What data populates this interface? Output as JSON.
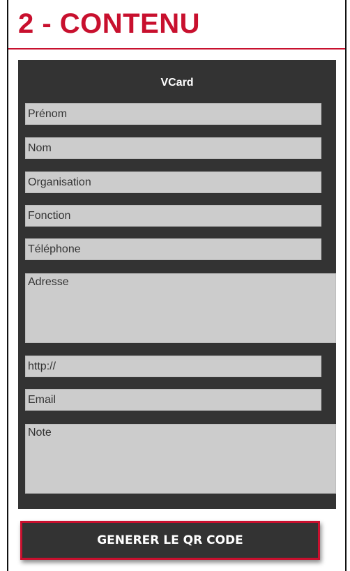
{
  "section": {
    "title": "2 - CONTENU"
  },
  "vcard": {
    "title": "VCard",
    "fields": {
      "first_name": {
        "placeholder": "Prénom",
        "value": ""
      },
      "last_name": {
        "placeholder": "Nom",
        "value": ""
      },
      "organisation": {
        "placeholder": "Organisation",
        "value": ""
      },
      "function": {
        "placeholder": "Fonction",
        "value": ""
      },
      "phone": {
        "placeholder": "Téléphone",
        "value": ""
      },
      "address": {
        "placeholder": "Adresse",
        "value": ""
      },
      "website": {
        "placeholder": "http://",
        "value": ""
      },
      "email": {
        "placeholder": "Email",
        "value": ""
      },
      "note": {
        "placeholder": "Note",
        "value": ""
      }
    }
  },
  "actions": {
    "generate_label": "GENERER LE QR CODE"
  },
  "colors": {
    "accent": "#c8102e",
    "panel": "#333333",
    "field": "#cccccc"
  }
}
